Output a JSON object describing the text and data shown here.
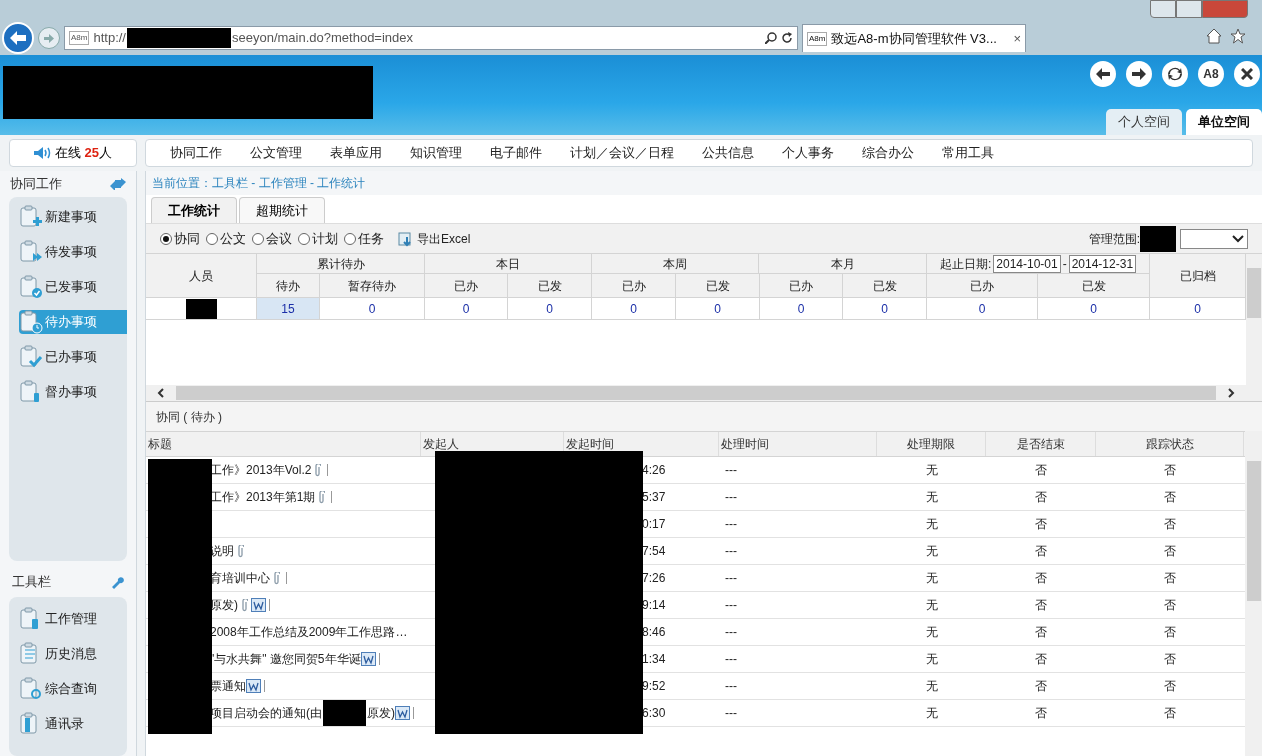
{
  "browser": {
    "url_prefix": "http://",
    "url_suffix": "seeyon/main.do?method=index",
    "tab_title": "致远A8-m协同管理软件 V3...",
    "tab_close": "×",
    "address_favicon": "A8m",
    "tab_favicon": "A8m"
  },
  "header": {
    "buttons": [
      {
        "kind": "back"
      },
      {
        "kind": "forward"
      },
      {
        "kind": "refresh"
      },
      {
        "kind": "text",
        "label": "A8"
      },
      {
        "kind": "close"
      }
    ],
    "spaces": [
      {
        "label": "个人空间",
        "selected": false
      },
      {
        "label": "单位空间",
        "selected": true
      }
    ]
  },
  "online": {
    "prefix": "在线",
    "count": "25",
    "suffix": "人"
  },
  "nav": [
    "协同工作",
    "公文管理",
    "表单应用",
    "知识管理",
    "电子邮件",
    "计划／会议／日程",
    "公共信息",
    "个人事务",
    "综合办公",
    "常用工具"
  ],
  "sidebar": {
    "title": "协同工作",
    "items": [
      {
        "label": "新建事项",
        "selected": false
      },
      {
        "label": "待发事项",
        "selected": false
      },
      {
        "label": "已发事项",
        "selected": false
      },
      {
        "label": "待办事项",
        "selected": true
      },
      {
        "label": "已办事项",
        "selected": false
      },
      {
        "label": "督办事项",
        "selected": false
      }
    ],
    "tools_title": "工具栏",
    "tools": [
      {
        "label": "工作管理"
      },
      {
        "label": "历史消息"
      },
      {
        "label": "综合查询"
      },
      {
        "label": "通讯录"
      }
    ]
  },
  "breadcrumb": "当前位置：工具栏 - 工作管理 - 工作统计",
  "tabs": [
    {
      "label": "工作统计",
      "selected": true
    },
    {
      "label": "超期统计",
      "selected": false
    }
  ],
  "types": [
    {
      "label": "协同",
      "selected": true
    },
    {
      "label": "公文",
      "selected": false
    },
    {
      "label": "会议",
      "selected": false
    },
    {
      "label": "计划",
      "selected": false
    },
    {
      "label": "任务",
      "selected": false
    }
  ],
  "export": "导出Excel",
  "scope_label": "管理范围:",
  "stats": {
    "person": "人员",
    "groups": [
      "累计待办",
      "本日",
      "本周",
      "本月"
    ],
    "sub": [
      "待办",
      "暂存待办",
      "已办",
      "已发",
      "已办",
      "已发",
      "已办",
      "已发",
      "已办",
      "已发"
    ],
    "range_label": "起止日期:",
    "start": "2014-10-01",
    "separator": "-",
    "end": "2014-12-31",
    "archived": "已归档",
    "row": [
      "15",
      "0",
      "0",
      "0",
      "0",
      "0",
      "0",
      "0",
      "0",
      "0",
      "0"
    ]
  },
  "list": {
    "title": "协同 ( 待办 )",
    "columns": [
      "标题",
      "发起人",
      "发起时间",
      "处理时间",
      "处理期限",
      "是否结束",
      "跟踪状态"
    ],
    "rows": [
      {
        "title": "工作》2013年Vol.2",
        "attach": true,
        "word": false,
        "bar": true,
        "time": "4:26",
        "handled": "---",
        "limit": "无",
        "ended": "否",
        "track": "否"
      },
      {
        "title": "工作》2013年第1期",
        "attach": true,
        "word": false,
        "bar": true,
        "time": "5:37",
        "handled": "---",
        "limit": "无",
        "ended": "否",
        "track": "否"
      },
      {
        "title": "",
        "attach": false,
        "word": false,
        "bar": false,
        "time": "0:17",
        "handled": "---",
        "limit": "无",
        "ended": "否",
        "track": "否"
      },
      {
        "title": "说明",
        "attach": true,
        "word": false,
        "bar": false,
        "time": "7:54",
        "handled": "---",
        "limit": "无",
        "ended": "否",
        "track": "否"
      },
      {
        "title": "育培训中心",
        "attach": true,
        "word": false,
        "bar": true,
        "time": "7:26",
        "handled": "---",
        "limit": "无",
        "ended": "否",
        "track": "否"
      },
      {
        "title": "原发)",
        "attach": true,
        "word": true,
        "bar": true,
        "time": "9:14",
        "handled": "---",
        "limit": "无",
        "ended": "否",
        "track": "否"
      },
      {
        "title": "2008年工作总结及2009年工作思路…",
        "attach": false,
        "word": false,
        "bar": false,
        "time": "8:46",
        "handled": "---",
        "limit": "无",
        "ended": "否",
        "track": "否"
      },
      {
        "title": "\"与水共舞\" 邀您同贺5年华诞",
        "attach": false,
        "word": true,
        "bar": true,
        "time": "1:34",
        "handled": "---",
        "limit": "无",
        "ended": "否",
        "track": "否"
      },
      {
        "title": "票通知",
        "attach": false,
        "word": true,
        "bar": true,
        "time": "9:52",
        "handled": "---",
        "limit": "无",
        "ended": "否",
        "track": "否"
      },
      {
        "title": "项目启动会的通知(由",
        "title_tail": "原发)",
        "attach": false,
        "word": true,
        "bar": true,
        "time": "6:30",
        "handled": "---",
        "limit": "无",
        "ended": "否",
        "track": "否"
      }
    ]
  }
}
